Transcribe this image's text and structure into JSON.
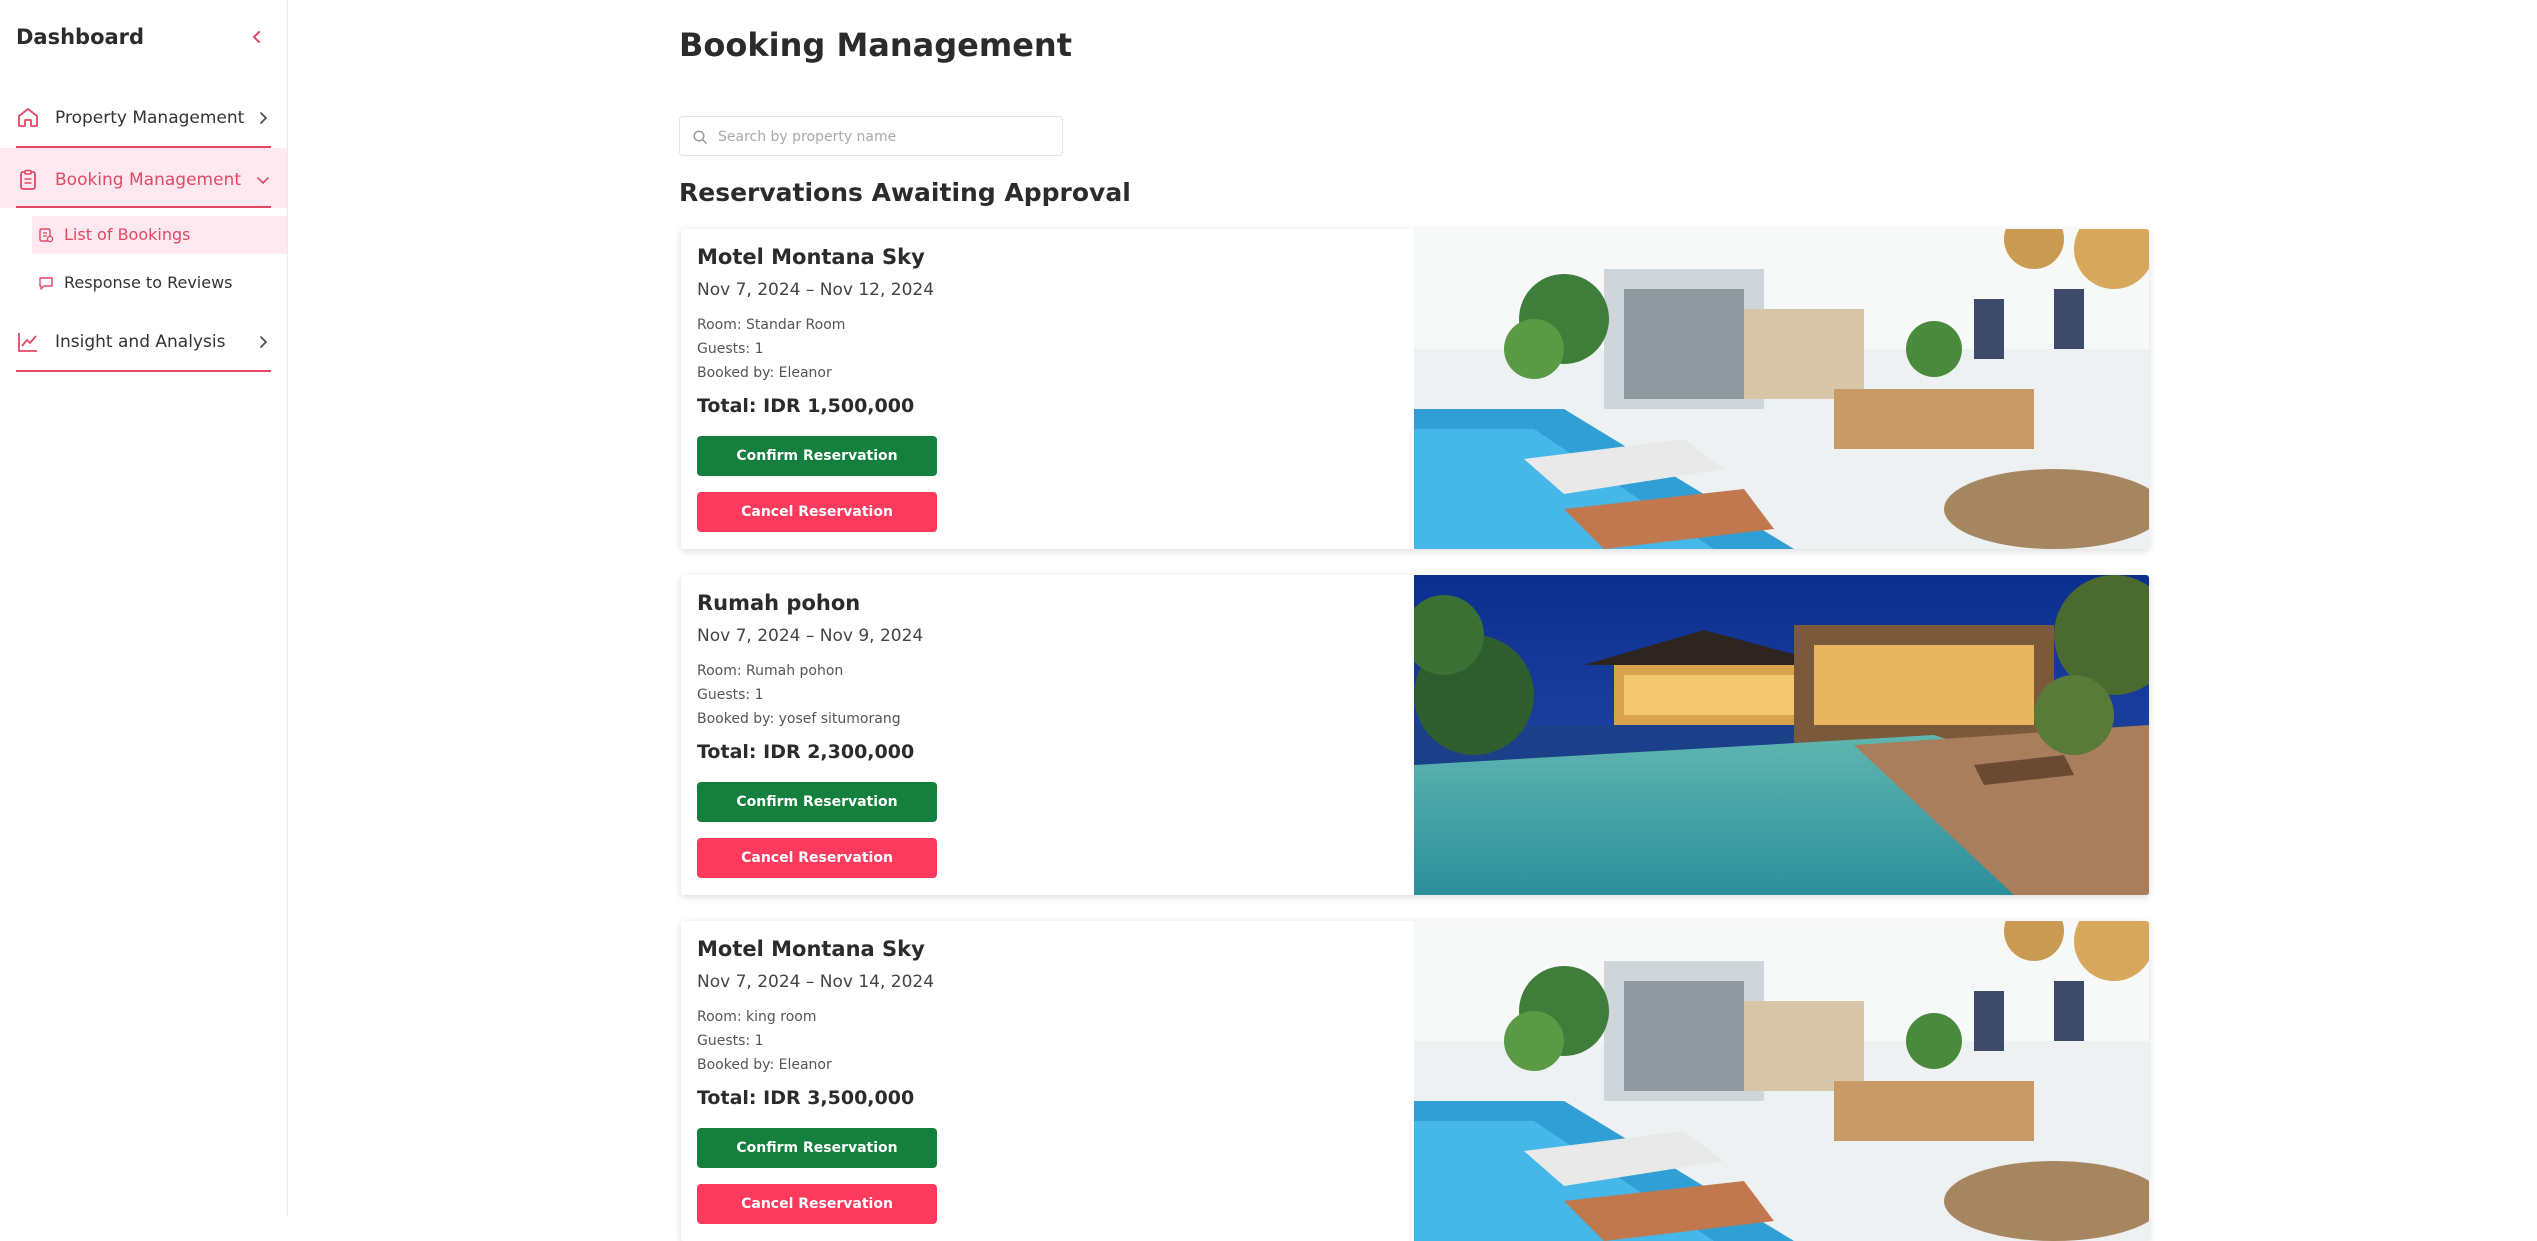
{
  "sidebar": {
    "title": "Dashboard",
    "nav": [
      {
        "label": "Property Management",
        "icon": "home-icon"
      },
      {
        "label": "Booking Management",
        "icon": "clipboard-icon",
        "active": true
      },
      {
        "label": "Insight and Analysis",
        "icon": "line-chart-icon"
      }
    ],
    "sub_items": [
      {
        "label": "List of Bookings",
        "icon": "list-bookings-icon",
        "active": true
      },
      {
        "label": "Response to Reviews",
        "icon": "message-icon"
      }
    ],
    "accent_color": "#e24866"
  },
  "main": {
    "title": "Booking Management",
    "search": {
      "placeholder": "Search by property name",
      "value": ""
    },
    "section_title": "Reservations Awaiting Approval",
    "reservations": [
      {
        "property": "Motel Montana Sky",
        "dates": "Nov 7, 2024 – Nov 12, 2024",
        "room": "Room: Standar Room",
        "guests": "Guests: 1",
        "booked_by": "Booked by: Eleanor",
        "total": "Total: IDR 1,500,000",
        "confirm_label": "Confirm Reservation",
        "cancel_label": "Cancel Reservation",
        "image": "villa-interior-pool-photo"
      },
      {
        "property": "Rumah pohon",
        "dates": "Nov 7, 2024 – Nov 9, 2024",
        "room": "Room: Rumah pohon",
        "guests": "Guests: 1",
        "booked_by": "Booked by: yosef situmorang",
        "total": "Total: IDR 2,300,000",
        "confirm_label": "Confirm Reservation",
        "cancel_label": "Cancel Reservation",
        "image": "infinity-pool-night-photo"
      },
      {
        "property": "Motel Montana Sky",
        "dates": "Nov 7, 2024 – Nov 14, 2024",
        "room": "Room: king room",
        "guests": "Guests: 1",
        "booked_by": "Booked by: Eleanor",
        "total": "Total: IDR 3,500,000",
        "confirm_label": "Confirm Reservation",
        "cancel_label": "Cancel Reservation",
        "image": "villa-interior-pool-photo"
      }
    ],
    "confirm_color": "#15803d",
    "cancel_color": "#fb3a5d"
  }
}
